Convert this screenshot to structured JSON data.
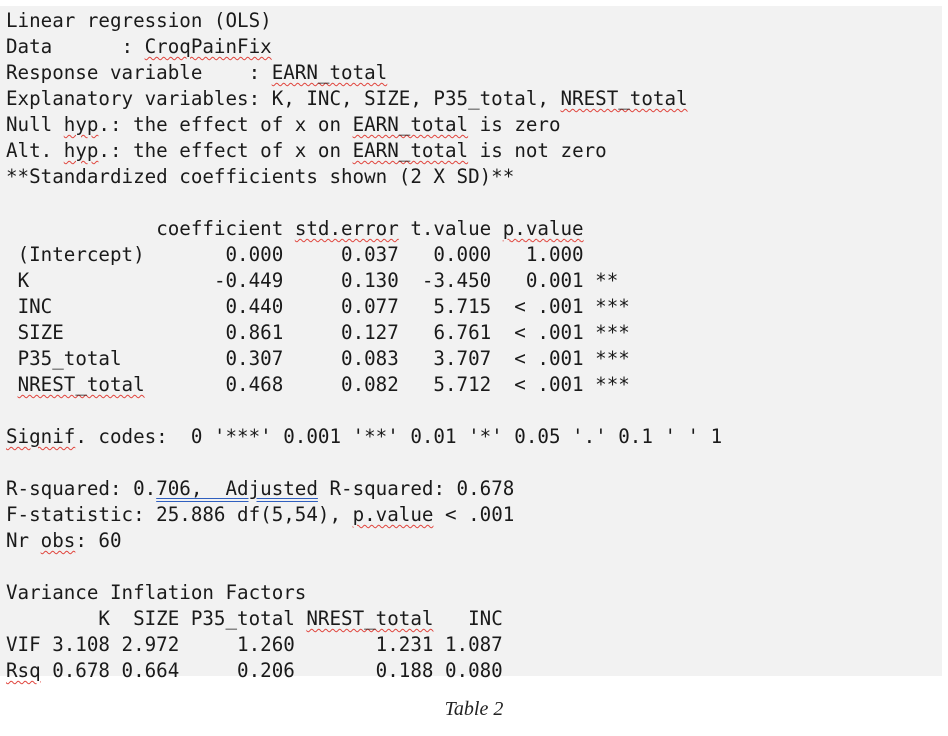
{
  "header": {
    "title": "Linear regression (OLS)",
    "data_label": "Data      : ",
    "data_value": "CroqPainFix",
    "response_label": "Response variable    : ",
    "response_value": "EARN_total",
    "explanatory_label": "Explanatory variables: K, INC, SIZE, P35_total, ",
    "explanatory_last": "NREST_total",
    "null_a": "Null ",
    "null_hyp": "hyp",
    "null_b": ".: the effect of x on ",
    "null_var": "EARN_total",
    "null_c": " is zero",
    "alt_a": "Alt. ",
    "alt_hyp": "hyp",
    "alt_b": ".: the effect of x on ",
    "alt_var": "EARN_total",
    "alt_c": " is not zero",
    "std_note": "**Standardized coefficients shown (2 X SD)**"
  },
  "coef_table": {
    "header_pad": "             ",
    "col_coef": "coefficient ",
    "col_se": "std.error",
    "col_t": " t.value ",
    "col_p": "p.value",
    "rows": [
      {
        "pad": " ",
        "name": "(Intercept)",
        "rest": "       0.000     0.037   0.000   1.000"
      },
      {
        "pad": " ",
        "name": "K",
        "rest": "                -0.449     0.130  -3.450   0.001 **"
      },
      {
        "pad": " ",
        "name": "INC",
        "rest": "               0.440     0.077   5.715  < .001 ***"
      },
      {
        "pad": " ",
        "name": "SIZE",
        "rest": "              0.861     0.127   6.761  < .001 ***"
      },
      {
        "pad": " ",
        "name": "P35_total",
        "rest": "         0.307     0.083   3.707  < .001 ***"
      },
      {
        "pad": " ",
        "name": "NREST_total",
        "rest": "       0.468     0.082   5.712  < .001 ***"
      }
    ]
  },
  "signif": {
    "word": "Signif",
    "rest": ". codes:  0 '***' 0.001 '**' 0.01 '*' 0.05 '.' 0.1 ' ' 1"
  },
  "fit": {
    "r2_a": "R-squared: 0.",
    "r2_b": "706,  Adjusted",
    "r2_c": " R-squared: 0.678",
    "f_a": "F-statistic: 25.886 df(5,54), ",
    "f_b": "p.value",
    "f_c": " < .001",
    "nr_a": "Nr ",
    "nr_b": "obs",
    "nr_c": ": 60"
  },
  "vif": {
    "title": "Variance Inflation Factors",
    "head_a": "        K  SIZE P35_total ",
    "head_b": "NREST_total",
    "head_c": "   INC",
    "vif_row": "VIF 3.108 2.972     1.260       1.231 1.087",
    "rsq_word": "Rsq",
    "rsq_rest": " 0.678 0.664     0.206       0.188 0.080"
  },
  "caption": "Table 2"
}
